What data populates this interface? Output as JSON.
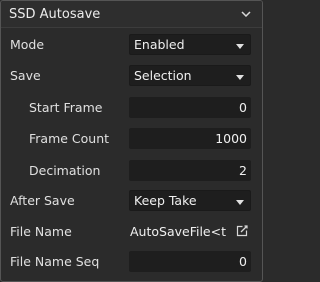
{
  "header": {
    "title": "SSD Autosave"
  },
  "icons": {
    "collapse": "chevron-down-icon",
    "dropdown": "caret-down-icon",
    "edit": "edit-external-icon"
  },
  "fields": {
    "mode": {
      "label": "Mode",
      "value": "Enabled"
    },
    "save": {
      "label": "Save",
      "value": "Selection"
    },
    "start_frame": {
      "label": "Start Frame",
      "value": "0"
    },
    "frame_count": {
      "label": "Frame Count",
      "value": "1000"
    },
    "decimation": {
      "label": "Decimation",
      "value": "2"
    },
    "after_save": {
      "label": "After Save",
      "value": "Keep Take"
    },
    "file_name": {
      "label": "File Name",
      "value": "AutoSaveFile<ti"
    },
    "file_name_seq": {
      "label": "File Name Seq",
      "value": "0"
    }
  }
}
